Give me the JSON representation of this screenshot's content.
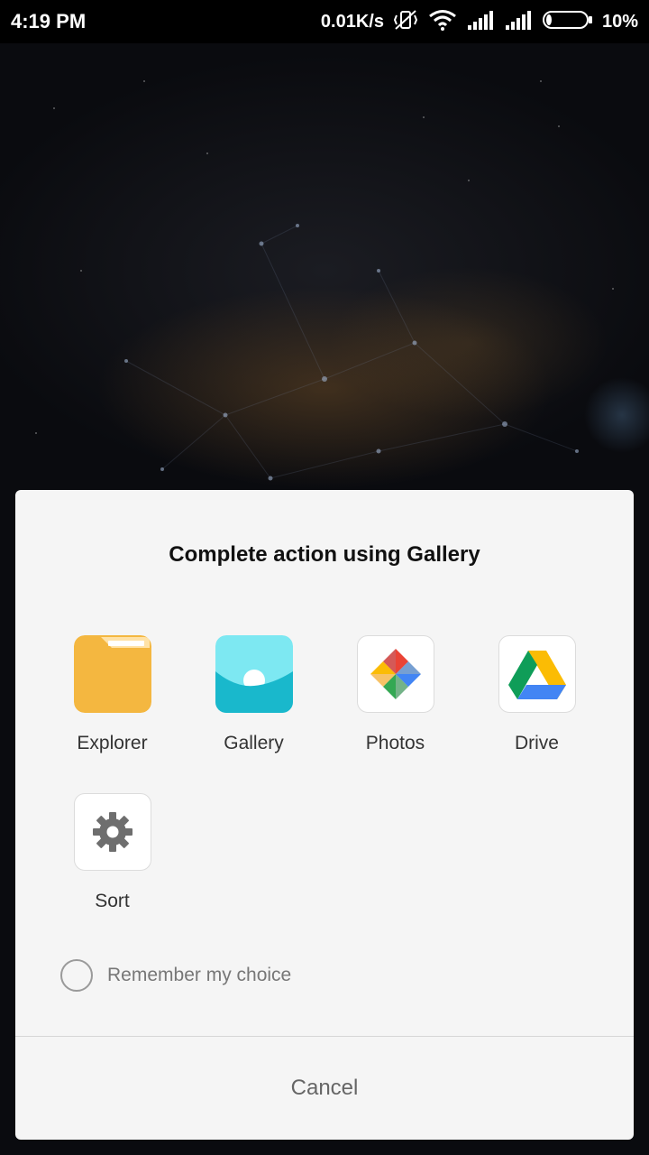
{
  "status_bar": {
    "time": "4:19 PM",
    "network_speed": "0.01K/s",
    "battery_percent": "10%",
    "battery_level": 0.1,
    "icons": [
      "vibrate-mute-icon",
      "wifi-icon",
      "signal-icon",
      "signal-icon",
      "battery-icon"
    ]
  },
  "dialog": {
    "title": "Complete action using Gallery",
    "apps": [
      {
        "label": "Explorer",
        "icon": "folder-icon"
      },
      {
        "label": "Gallery",
        "icon": "gallery-icon"
      },
      {
        "label": "Photos",
        "icon": "pinwheel-icon"
      },
      {
        "label": "Drive",
        "icon": "drive-icon"
      },
      {
        "label": "Sort",
        "icon": "gear-icon"
      }
    ],
    "remember_label": "Remember my choice",
    "remember_checked": false,
    "cancel_label": "Cancel"
  },
  "colors": {
    "explorer_folder": "#f4b740",
    "gallery_sky": "#7de8f2",
    "gallery_wave": "#19b8cc",
    "dialog_bg": "#f5f5f5"
  }
}
